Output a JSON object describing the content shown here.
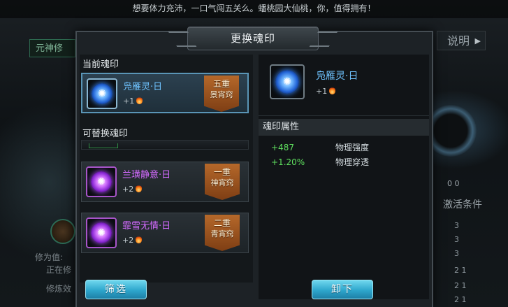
{
  "background": {
    "marquee": "想要体力充沛，一口气闯五关么。蟠桃园大仙桃，你，值得拥有！",
    "tab_left": "元神修",
    "tab_right": "说明",
    "left_label_1": "修为值:",
    "left_label_2": "正在修",
    "left_label_3": "修炼效",
    "right_counts": "0  0",
    "right_label": "激活条件",
    "right_rows": [
      "3",
      "3",
      "3",
      "2  1",
      "2  1",
      "2  1"
    ]
  },
  "dialog": {
    "title": "更换魂印",
    "current_label": "当前魂印",
    "replace_label": "可替换魂印",
    "current": {
      "name": "凫雁灵·日",
      "level": "+1",
      "badge_1": "五重",
      "badge_2": "景宵窍",
      "icon": "blue-swirl-orb-icon"
    },
    "options": [
      {
        "name": "兰璜静意·日",
        "level": "+2",
        "badge_1": "一重",
        "badge_2": "神宵窍",
        "icon": "purple-swirl-orb-icon"
      },
      {
        "name": "霏雪无情·日",
        "level": "+2",
        "badge_1": "二重",
        "badge_2": "青宵窍",
        "icon": "purple-swirl-orb-icon"
      }
    ],
    "filter_button": "筛选",
    "detail": {
      "name": "凫雁灵·日",
      "level": "+1",
      "attr_title": "魂印属性",
      "attrs": [
        {
          "value": "+487",
          "name": "物理强度"
        },
        {
          "value": "+1.20%",
          "name": "物理穿透"
        }
      ]
    },
    "unequip_button": "卸下"
  },
  "colors": {
    "accent_blue": "#6fc3ff",
    "accent_purple": "#d36bff",
    "stat_green": "#5fe05f",
    "button_cyan": "#2ea6cc"
  }
}
